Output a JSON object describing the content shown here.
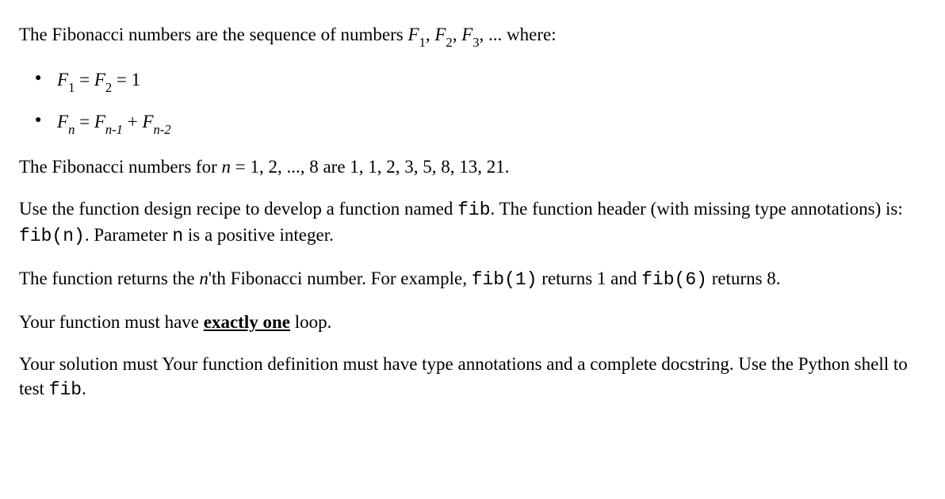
{
  "para1": {
    "t1": "The Fibonacci numbers are the sequence of numbers ",
    "f1": "F",
    "s1": "1",
    "c1": ", ",
    "f2": "F",
    "s2": "2",
    "c2": ", ",
    "f3": "F",
    "s3": "3",
    "c3": ", ... where:"
  },
  "bullet1": {
    "f1": "F",
    "s1": "1",
    "eq1": " = ",
    "f2": "F",
    "s2": "2",
    "eq2": " = 1"
  },
  "bullet2": {
    "f1": "F",
    "s1": "n",
    "eq1": " = ",
    "f2": "F",
    "s2": "n-1",
    "plus": " + ",
    "f3": "F",
    "s3": "n-2"
  },
  "para2": {
    "t1": "The Fibonacci numbers for ",
    "n": "n",
    "t2": " = 1, 2, ..., 8 are 1, 1, 2, 3, 5, 8, 13, 21."
  },
  "para3": {
    "t1": "Use the function design recipe to develop a function named ",
    "code1": "fib",
    "t2": ". The function header (with missing type annotations) is: ",
    "code2": "fib(n)",
    "t3": ". Parameter ",
    "code3": "n",
    "t4": " is a positive integer."
  },
  "para4": {
    "t1": "The function returns the ",
    "n": "n",
    "t2": "'th Fibonacci number. For example, ",
    "code1": "fib(1)",
    "t3": " returns 1 and ",
    "code2": "fib(6)",
    "t4": " returns 8."
  },
  "para5": {
    "t1": "Your function must have ",
    "emph": "exactly one",
    "t2": " loop."
  },
  "para6": {
    "t1": "Your solution must Your function definition must have type annotations and a complete docstring. Use the Python shell to test ",
    "code1": "fib",
    "t2": "."
  }
}
